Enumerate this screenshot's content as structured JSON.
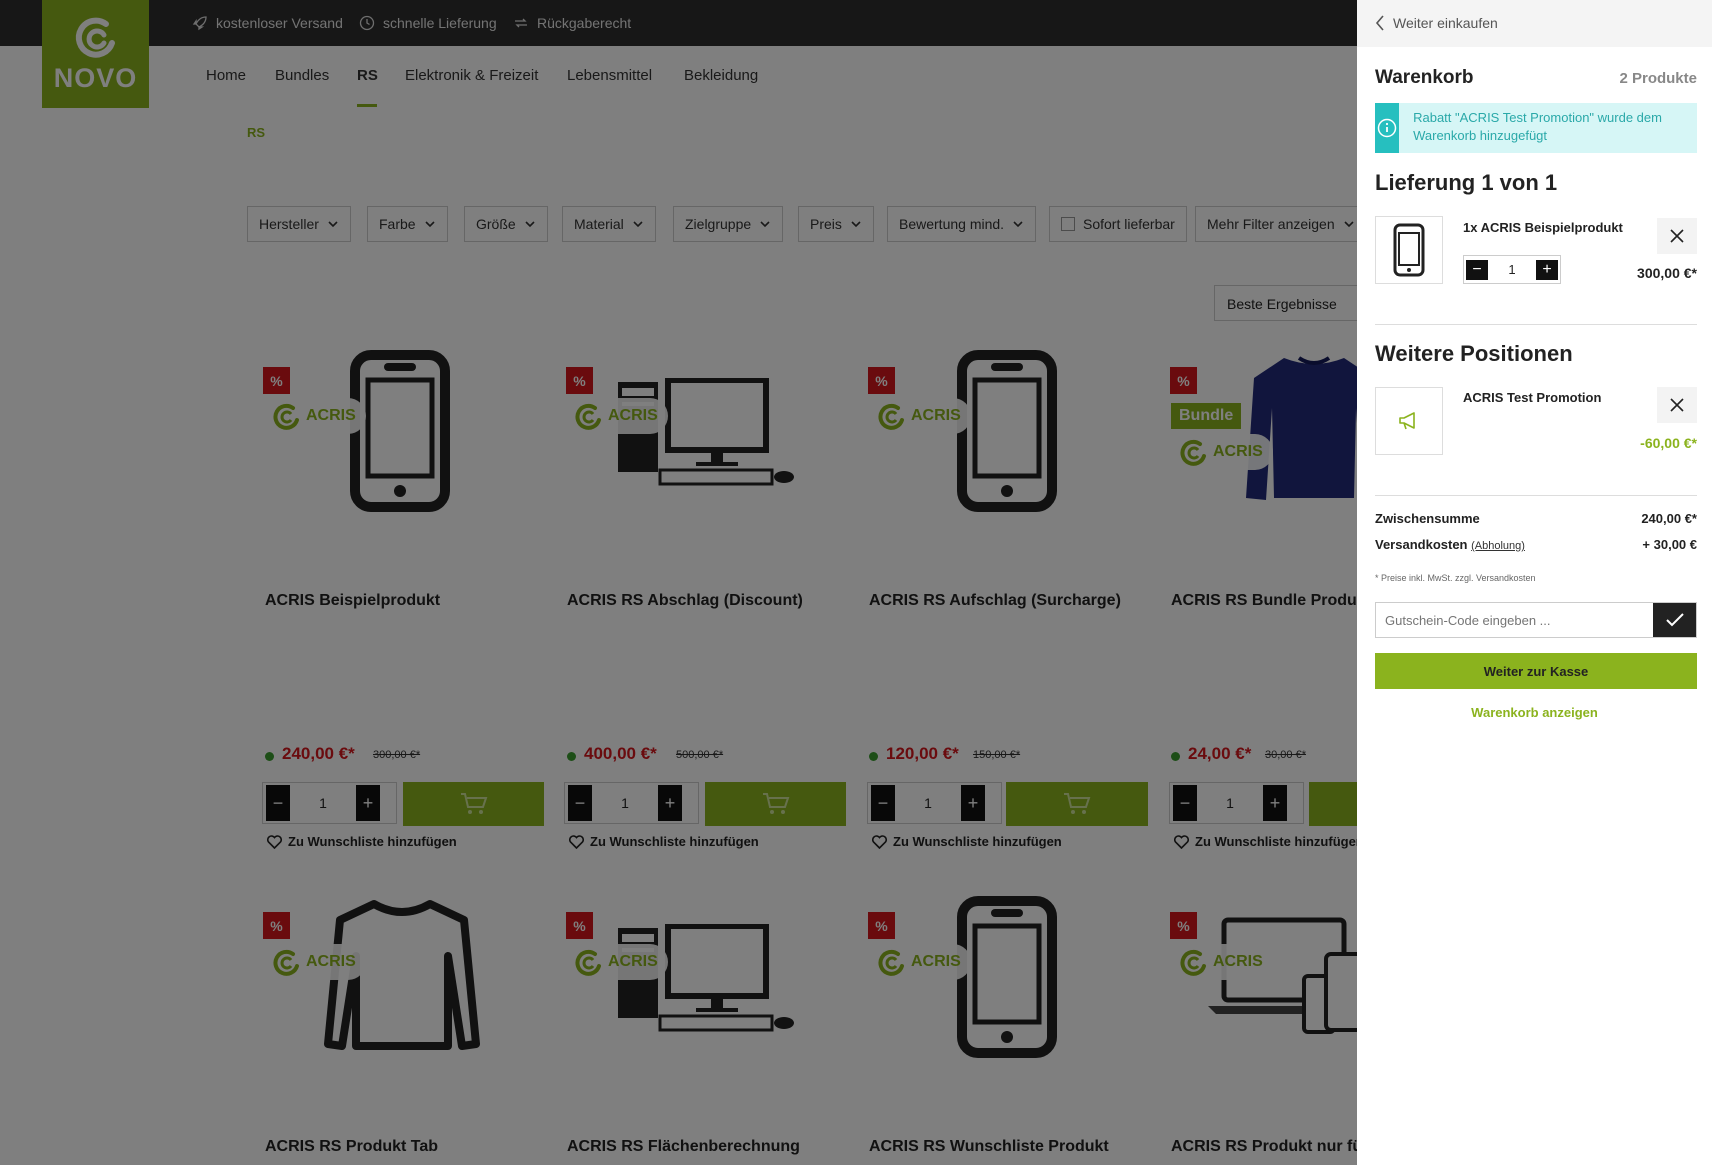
{
  "topbar": {
    "usps": [
      "kostenloser Versand",
      "schnelle Lieferung",
      "Rückgaberecht"
    ]
  },
  "logo": {
    "text": "NOVO"
  },
  "nav": {
    "items": [
      "Home",
      "Bundles",
      "RS",
      "Elektronik & Freizeit",
      "Lebensmittel",
      "Bekleidung"
    ],
    "active": "RS"
  },
  "breadcrumb": "RS",
  "filters": {
    "items": [
      "Hersteller",
      "Farbe",
      "Größe",
      "Material",
      "Zielgruppe",
      "Preis",
      "Bewertung mind.",
      "Sofort lieferbar",
      "Mehr Filter anzeigen"
    ],
    "sort": "Beste Ergebnisse"
  },
  "products": [
    {
      "name": "ACRIS Beispielprodukt",
      "price": "240,00 €*",
      "old_price": "300,00 €*",
      "qty": "1",
      "badge": "ACRIS",
      "discount": "%",
      "icon": "phone-icon"
    },
    {
      "name": "ACRIS RS Abschlag (Discount)",
      "price": "400,00 €*",
      "old_price": "500,00 €*",
      "qty": "1",
      "badge": "ACRIS",
      "discount": "%",
      "icon": "desktop-computer-icon"
    },
    {
      "name": "ACRIS RS Aufschlag (Surcharge)",
      "price": "120,00 €*",
      "old_price": "150,00 €*",
      "qty": "1",
      "badge": "ACRIS",
      "discount": "%",
      "icon": "phone-icon"
    },
    {
      "name": "ACRIS RS Bundle Produk",
      "price": "24,00 €*",
      "old_price": "30,00 €*",
      "qty": "1",
      "badge": "ACRIS",
      "bundle": "Bundle",
      "discount": "%",
      "icon": "sweater-icon"
    },
    {
      "name": "ACRIS RS Produkt Tab",
      "badge": "ACRIS",
      "discount": "%",
      "icon": "longsleeve-icon"
    },
    {
      "name": "ACRIS RS Flächenberechnung",
      "badge": "ACRIS",
      "discount": "%",
      "icon": "desktop-computer-icon"
    },
    {
      "name": "ACRIS RS Wunschliste Produkt",
      "badge": "ACRIS",
      "discount": "%",
      "icon": "phone-icon"
    },
    {
      "name": "ACRIS RS Produkt nur fü",
      "badge": "ACRIS",
      "discount": "%",
      "icon": "devices-icon"
    }
  ],
  "wishlist_label": "Zu Wunschliste hinzufügen",
  "cart": {
    "back_label": "Weiter einkaufen",
    "title": "Warenkorb",
    "count": "2 Produkte",
    "alert": "Rabatt \"ACRIS Test Promotion\" wurde dem Warenkorb hinzugefügt",
    "delivery_title": "Lieferung 1 von 1",
    "item": {
      "name": "1x ACRIS Beispielprodukt",
      "qty": "1",
      "price": "300,00 €*"
    },
    "further_title": "Weitere Positionen",
    "promo": {
      "name": "ACRIS Test Promotion",
      "price": "-60,00 €*"
    },
    "subtotal_label": "Zwischensumme",
    "subtotal": "240,00 €*",
    "shipping_label": "Versandkosten",
    "shipping_method": "(Abholung)",
    "shipping": "+ 30,00 €",
    "note": "* Preise inkl. MwSt. zzgl. Versandkosten",
    "voucher_placeholder": "Gutschein-Code eingeben ...",
    "checkout_label": "Weiter zur Kasse",
    "show_cart_label": "Warenkorb anzeigen"
  },
  "colors": {
    "brand_green": "#8bb31e",
    "sale_red": "#d4161c",
    "info_teal": "#26bfbf"
  }
}
